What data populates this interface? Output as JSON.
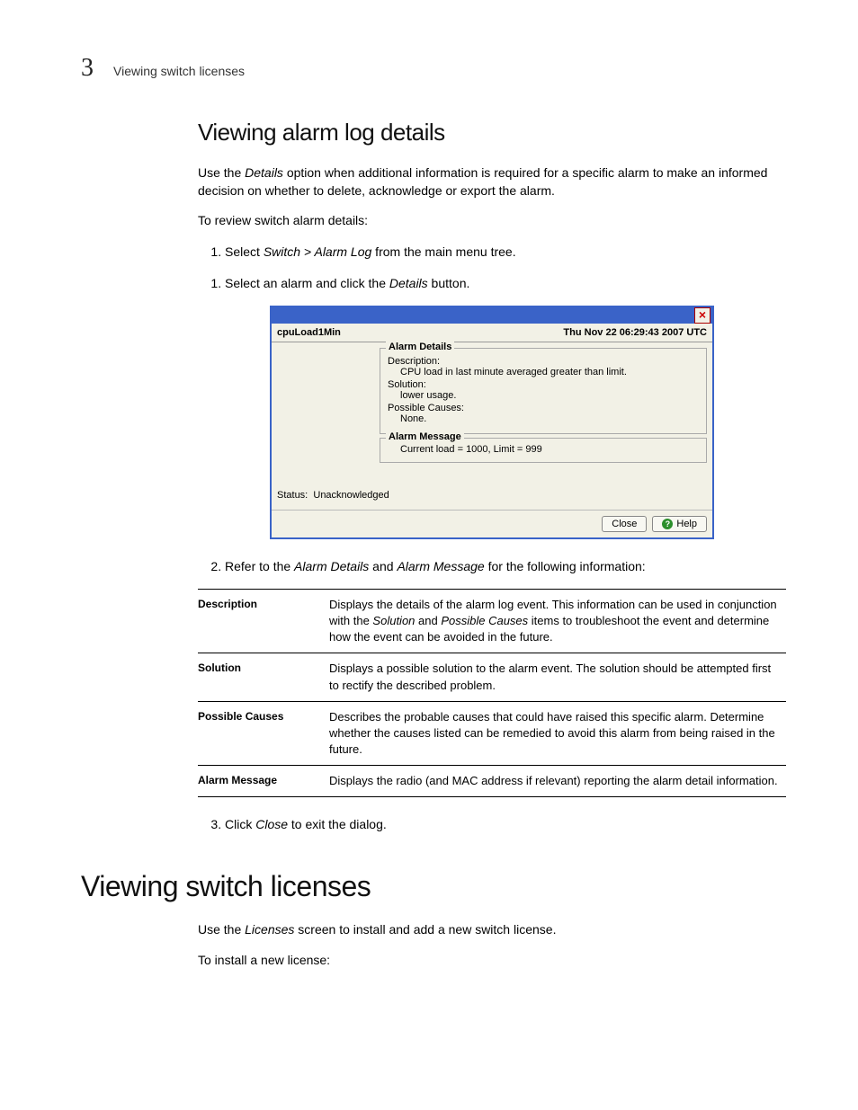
{
  "header": {
    "chapter_number": "3",
    "running_title": "Viewing switch licenses"
  },
  "section1": {
    "heading": "Viewing alarm log details",
    "intro_pre": "Use the ",
    "intro_em": "Details",
    "intro_post": " option when additional information is required for a specific alarm to make an informed decision on whether to delete, acknowledge or export the alarm.",
    "review_line": "To review switch alarm details:",
    "step1_pre": "Select ",
    "step1_em": "Switch > Alarm Log",
    "step1_post": " from the main menu tree.",
    "step1b_pre": "Select an alarm and click the ",
    "step1b_em": "Details",
    "step1b_post": " button.",
    "step2_pre": "Refer to the ",
    "step2_em1": "Alarm Details",
    "step2_mid": " and ",
    "step2_em2": "Alarm Message",
    "step2_post": " for the following information:",
    "step3_pre": "Click ",
    "step3_em": "Close",
    "step3_post": " to exit the dialog."
  },
  "dialog": {
    "name": "cpuLoad1Min",
    "timestamp": "Thu Nov 22 06:29:43 2007 UTC",
    "details_legend": "Alarm Details",
    "desc_label": "Description:",
    "desc_value": "CPU load in last minute averaged greater than limit.",
    "sol_label": "Solution:",
    "sol_value": "lower usage.",
    "cause_label": "Possible Causes:",
    "cause_value": "None.",
    "msg_legend": "Alarm Message",
    "msg_value": "Current load = 1000, Limit = 999",
    "status_label": "Status:",
    "status_value": "Unacknowledged",
    "close_btn": "Close",
    "help_btn": "Help"
  },
  "defs": [
    {
      "term": "Description",
      "body_pre": "Displays the details of the alarm log event. This information can be used in conjunction with the ",
      "body_em1": "Solution",
      "body_mid": " and ",
      "body_em2": "Possible Causes",
      "body_post": " items to troubleshoot the event and determine how the event can be avoided in the future."
    },
    {
      "term": "Solution",
      "body": "Displays a possible solution to the alarm event. The solution should be attempted first to rectify the described problem."
    },
    {
      "term": "Possible Causes",
      "body": "Describes the probable causes that could have raised this specific alarm. Determine whether the causes listed can be remedied to avoid this alarm from being raised in the future."
    },
    {
      "term": "Alarm Message",
      "body": "Displays the radio (and MAC address if relevant) reporting the alarm detail information."
    }
  ],
  "section2": {
    "heading": "Viewing switch licenses",
    "intro_pre": "Use the ",
    "intro_em": "Licenses",
    "intro_post": " screen to install and add a new switch license.",
    "install_line": "To install a new license:"
  }
}
